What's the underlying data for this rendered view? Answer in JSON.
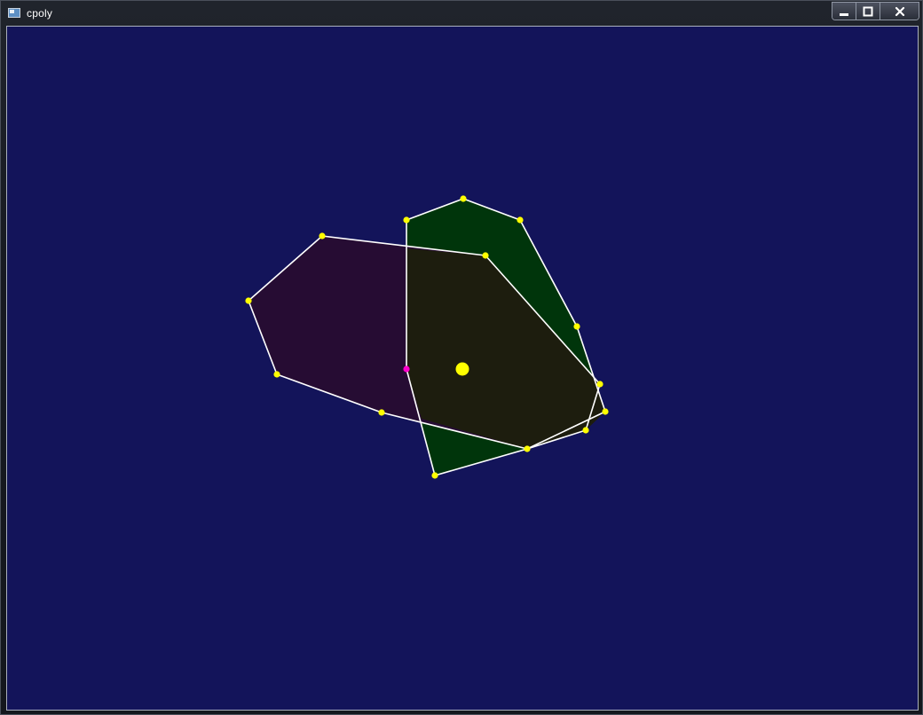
{
  "window": {
    "title": "cpoly",
    "icon": "app-window-icon",
    "controls": {
      "minimize_icon": "minimize-icon",
      "maximize_icon": "maximize-icon",
      "close_icon": "close-icon"
    }
  },
  "colors": {
    "canvas_background": "#13145a",
    "polygon_a_fill": "#260c33",
    "polygon_b_fill": "#00350b",
    "overlap_fill": "#1d1d0e",
    "edge_stroke": "#ffffff",
    "vertex": "#ffff00",
    "selected_vertex": "#ff00cc",
    "center_point": "#ffff00"
  }
}
